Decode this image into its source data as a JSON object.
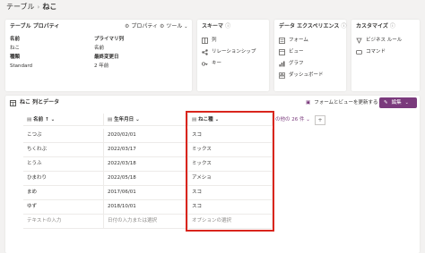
{
  "breadcrumb": {
    "parent": "テーブル",
    "separator": "›",
    "current": "ねこ"
  },
  "table_properties": {
    "title": "テーブル プロパティ",
    "properties_button": "プロパティ",
    "tools_button": "ツール",
    "fields": [
      {
        "label": "名前",
        "value": "ねこ"
      },
      {
        "label": "種類",
        "value": "Standard"
      }
    ],
    "fields_right": [
      {
        "label": "プライマリ列",
        "value": "名前"
      },
      {
        "label": "最終変更日",
        "value": "2 年前"
      }
    ]
  },
  "schema": {
    "title": "スキーマ",
    "items": [
      {
        "label": "列",
        "icon": "column-icon"
      },
      {
        "label": "リレーションシップ",
        "icon": "relationship-icon"
      },
      {
        "label": "キー",
        "icon": "key-icon"
      }
    ]
  },
  "data_experience": {
    "title": "データ エクスペリエンス",
    "items": [
      {
        "label": "フォーム",
        "icon": "form-icon"
      },
      {
        "label": "ビュー",
        "icon": "view-icon"
      },
      {
        "label": "グラフ",
        "icon": "chart-icon"
      },
      {
        "label": "ダッシュボード",
        "icon": "dashboard-icon"
      }
    ]
  },
  "customize": {
    "title": "カスタマイズ",
    "items": [
      {
        "label": "ビジネス ルール",
        "icon": "business-rule-icon"
      },
      {
        "label": "コマンド",
        "icon": "command-icon"
      }
    ]
  },
  "data_section": {
    "title": "ねこ 列とデータ",
    "update_link": "フォームとビューを更新する",
    "edit_button": "編集",
    "other_columns": "の他の 26 件",
    "add_column": "+"
  },
  "grid": {
    "columns": [
      "名前",
      "生年月日",
      "ねこ種"
    ],
    "sort_indicator": "↑",
    "rows": [
      [
        "こつぶ",
        "2020/02/01",
        "スコ"
      ],
      [
        "ちくわぶ",
        "2022/03/17",
        "ミックス"
      ],
      [
        "とうふ",
        "2022/03/18",
        "ミックス"
      ],
      [
        "ひまわり",
        "2022/05/18",
        "アメショ"
      ],
      [
        "まめ",
        "2017/06/01",
        "スコ"
      ],
      [
        "ゆず",
        "2018/10/01",
        "スコ"
      ]
    ],
    "input_placeholders": [
      "テキストの入力",
      "日付の入力または選択",
      "オプションの選択"
    ]
  },
  "colors": {
    "accent": "#7a3a7c",
    "highlight": "#d9251d",
    "background": "#f3f2f1"
  }
}
